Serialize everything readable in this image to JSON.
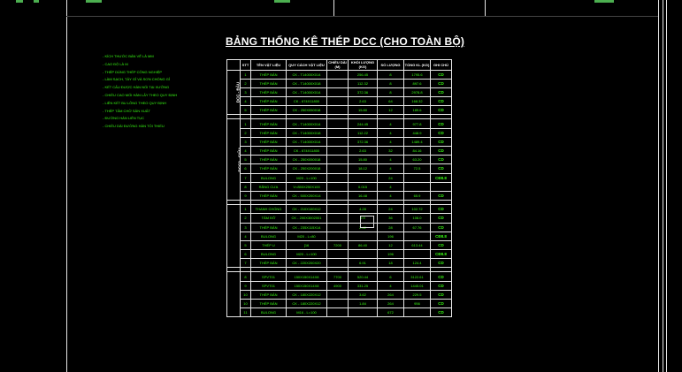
{
  "drawing": {
    "title": "BẢNG THỐNG KÊ THÉP DCC (CHO TOÀN BỘ)"
  },
  "notes": [
    "- KÍCH THƯỚC BẢN VẼ LÀ MM",
    "- CAO ĐỘ LÀ M",
    "- THÉP DÙNG THÉP CÔNG NGHIỆP",
    "- LÀM SẠCH, TẨY GỈ VÀ SƠN CHỐNG GỈ",
    "- KẾT CẤU ĐƯỢC HÀN NỐI TẠI XƯỞNG",
    "- CHIỀU CAO MỐI HÀN LẤY THEO QUY ĐỊNH",
    "- LIÊN KẾT BU LÔNG THEO QUY ĐỊNH",
    "- THÉP TẤM CHỜ SẢN XUẤT",
    "- ĐƯỜNG HÀN LIÊN TỤC",
    "- CHIỀU DÀI ĐƯỜNG HÀN TỐI THIỂU"
  ],
  "table": {
    "headers": [
      "STT",
      "TÊN VẬT LIỆU",
      "QUY CÁCH VẬT LIỆU",
      "CHIỀU DÀI (M)",
      "KHỐI LƯỢNG (KG)",
      "SỐ LƯỢNG",
      "TỔNG KL (KG)",
      "GHI CHÚ"
    ],
    "groups": [
      {
        "label": "DCC - ĐẦU",
        "rows": [
          [
            "1",
            "THÉP BẢN",
            "CK - T14000X014",
            "",
            "256.45",
            "8",
            "1795.6",
            "CD"
          ],
          [
            "2",
            "THÉP BẢN",
            "CK - T14000X018",
            "",
            "112.32",
            "8",
            "897.6",
            "CD"
          ],
          [
            "3",
            "THÉP BẢN",
            "CK - T14000X014",
            "",
            "372.36",
            "8",
            "2978.8",
            "CD"
          ],
          [
            "4",
            "THÉP BẢN",
            "CK - 674X11800",
            "",
            "2.63",
            "64",
            "168.32",
            "CD"
          ],
          [
            "5",
            "THÉP BẢN",
            "CK - 250X050018",
            "",
            "15.80",
            "12",
            "189.6",
            "CD"
          ]
        ]
      },
      {
        "label": "DCC2 - GIỮA",
        "rows": [
          [
            "1",
            "THÉP BẢN",
            "CK - T14000X014",
            "",
            "244.45",
            "4",
            "977.8",
            "CD"
          ],
          [
            "2",
            "THÉP BẢN",
            "CK - T14000X018",
            "",
            "112.22",
            "4",
            "448.9",
            "CD"
          ],
          [
            "3",
            "THÉP BẢN",
            "CK - T14000X014",
            "",
            "372.36",
            "4",
            "1489.4",
            "CD"
          ],
          [
            "4",
            "THÉP BẢN",
            "CK - 674X11800",
            "",
            "2.63",
            "32",
            "84.16",
            "CD"
          ],
          [
            "5",
            "THÉP BẢN",
            "CK - 250X050018",
            "",
            "15.80",
            "4",
            "63.20",
            "CD"
          ],
          [
            "6",
            "THÉP BẢN",
            "CK - 250X200018",
            "",
            "18.12",
            "4",
            "72.5",
            "CD"
          ],
          [
            "7",
            "BULONG",
            "M20 - L=100",
            "",
            "",
            "24",
            "",
            "CĐ8.8"
          ],
          [
            "8",
            "RĂNG CƯA",
            "V=850X250X100",
            "",
            "0.015",
            "4",
            "",
            ""
          ],
          [
            "9",
            "THÉP BẢN",
            "CK - 500X200X14",
            "",
            "16.48",
            "4",
            "65.9",
            "CD"
          ]
        ]
      },
      {
        "label": "LẮP DCC GỐI ĐỠ",
        "rows": [
          [
            "1",
            "THANH CHỐNG",
            "CK - 210X100X12",
            "",
            "4.28",
            "24",
            "102.72",
            "CD"
          ],
          [
            "2",
            "TÂM ĐỠ",
            "CK - 200X3002001",
            "",
            "9.9",
            "36",
            "108.0",
            "CD"
          ],
          [
            "3",
            "THÉP BẢN",
            "CK - 235X115X14",
            "",
            "2.42",
            "28",
            "67.76",
            "CD"
          ],
          [
            "4",
            "BULONG",
            "M20 - L=80",
            "",
            "",
            "196",
            "",
            "CĐ8.8"
          ],
          [
            "5",
            "THÉP U",
            "[16",
            "7200",
            "86.40",
            "12",
            "613.44",
            "CD"
          ],
          [
            "6",
            "BULONG",
            "M20 - L=100",
            "",
            "",
            "196",
            "",
            "CĐ8.8"
          ],
          [
            "7",
            "THÉP BẢN",
            "CK - 220X200X20",
            "",
            "6.91",
            "18",
            "124.4",
            "CD"
          ]
        ]
      },
      {
        "label": "NẸP & LIÊN KẾT",
        "rows": [
          [
            "8",
            "SPVT01",
            "150X150X14X8",
            "7700",
            "520.44",
            "6",
            "3122.61",
            "CD"
          ],
          [
            "9",
            "SPVT01",
            "150X150X14X8",
            "4900",
            "331.25",
            "4",
            "1445.01",
            "CD"
          ],
          [
            "10",
            "THÉP BẢN",
            "CK - 180X220X12",
            "",
            "3.62",
            "264",
            "229.5",
            "CD"
          ],
          [
            "10",
            "THÉP BẢN",
            "CK - 180X220X12",
            "",
            "1.84",
            "264",
            "956",
            "CD"
          ],
          [
            "11",
            "BULONG",
            "M16 - L=100",
            "",
            "",
            "672",
            "",
            "CD"
          ]
        ]
      }
    ]
  }
}
